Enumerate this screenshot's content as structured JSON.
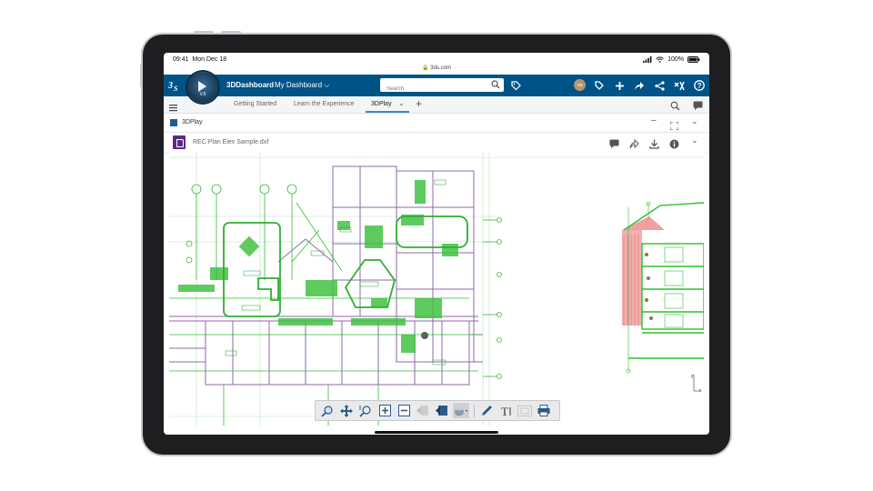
{
  "status": {
    "time": "09:41",
    "date": "Mon Dec 18",
    "battery": "100%"
  },
  "url": "3ds.com",
  "topbar": {
    "brand": "3DDashboard",
    "dashboard": "My Dashboard",
    "compass_version": "V.6",
    "search_placeholder": "Search",
    "avatar_initials": "VB"
  },
  "tabs": [
    {
      "label": "Getting Started"
    },
    {
      "label": "Learn the Experience"
    },
    {
      "label": "3DPlay"
    }
  ],
  "app": {
    "title": "3DPlay"
  },
  "document": {
    "title": "REC Plan Elev Sample.dxf"
  },
  "axis_labels": {
    "y": "y",
    "x": "x"
  },
  "colors": {
    "brand_blue": "#005386",
    "tab_accent": "#3b8bc7",
    "doc_icon": "#5b2b82",
    "drawing_green": "#2fbf2f",
    "drawing_purple": "#8d6aa8",
    "drawing_red": "#e06060"
  }
}
